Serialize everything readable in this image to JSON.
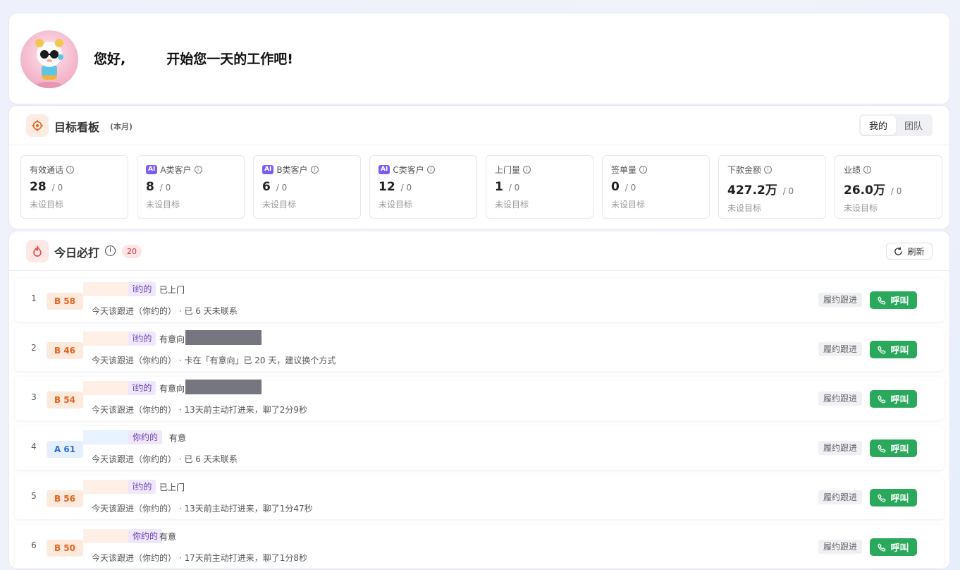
{
  "greeting": {
    "hello": "您好,",
    "message": "开始您一天的工作吧!"
  },
  "board": {
    "title": "目标看板",
    "period": "(本月)",
    "toggle": [
      "我的",
      "团队"
    ],
    "toggle_active": "我的",
    "metrics": [
      {
        "label": "有效通话",
        "ai": false,
        "value": "28",
        "total": "/ 0",
        "note": "未设目标"
      },
      {
        "label": "A类客户",
        "ai": true,
        "value": "8",
        "total": "/ 0",
        "note": "未设目标"
      },
      {
        "label": "B类客户",
        "ai": true,
        "value": "6",
        "total": "/ 0",
        "note": "未设目标"
      },
      {
        "label": "C类客户",
        "ai": true,
        "value": "12",
        "total": "/ 0",
        "note": "未设目标"
      },
      {
        "label": "上门量",
        "ai": false,
        "value": "1",
        "total": "/ 0",
        "note": "未设目标"
      },
      {
        "label": "签单量",
        "ai": false,
        "value": "0",
        "total": "/ 0",
        "note": "未设目标"
      },
      {
        "label": "下款金额",
        "ai": false,
        "value": "427.2万",
        "total": "/ 0",
        "note": "未设目标"
      },
      {
        "label": "业绩",
        "ai": false,
        "value": "26.0万",
        "total": "/ 0",
        "note": "未设目标"
      }
    ],
    "ai_tag": "AI",
    "info_glyph": "i"
  },
  "calls": {
    "title": "今日必打",
    "count": "20",
    "refresh_label": "刷新",
    "follow_label": "履约跟进",
    "call_label": "呼叫",
    "rows": [
      {
        "index": "1",
        "grade": "B 58",
        "grade_class": "b",
        "tag": "î约的",
        "status": "已上门",
        "redacted": false,
        "sub": "今天该跟进（你约的） · 已 6 天未联系"
      },
      {
        "index": "2",
        "grade": "B 46",
        "grade_class": "b",
        "tag": "î约的",
        "status": "有意向",
        "redacted": true,
        "sub": "今天该跟进（你约的） · 卡在「有意向」已 20 天，建议换个方式"
      },
      {
        "index": "3",
        "grade": "B 54",
        "grade_class": "b",
        "tag": "î约的",
        "status": "有意向",
        "redacted": true,
        "sub": "今天该跟进（你约的） · 13天前主动打进来，聊了2分9秒"
      },
      {
        "index": "4",
        "grade": "A 61",
        "grade_class": "a",
        "tag": "你约的",
        "status": "有意",
        "redacted": false,
        "sub": "今天该跟进（你约的） · 已 6 天未联系"
      },
      {
        "index": "5",
        "grade": "B 56",
        "grade_class": "b",
        "tag": "î约的",
        "status": "已上门",
        "redacted": false,
        "sub": "今天该跟进（你约的） · 13天前主动打进来，聊了1分47秒"
      },
      {
        "index": "6",
        "grade": "B 50",
        "grade_class": "b",
        "tag": "你约的",
        "status": "有意",
        "redacted": false,
        "sub": "今天该跟进（你约的） · 17天前主动打进来，聊了1分8秒"
      }
    ]
  },
  "colors": {
    "accent_orange": "#e5621c",
    "call_green": "#2aa85b",
    "ai_purple": "#7d5cf0",
    "badge_red": "#d9363e"
  },
  "icons": [
    "avatar-image",
    "target-icon",
    "flame-icon",
    "info-icon",
    "refresh-icon",
    "phone-icon"
  ]
}
